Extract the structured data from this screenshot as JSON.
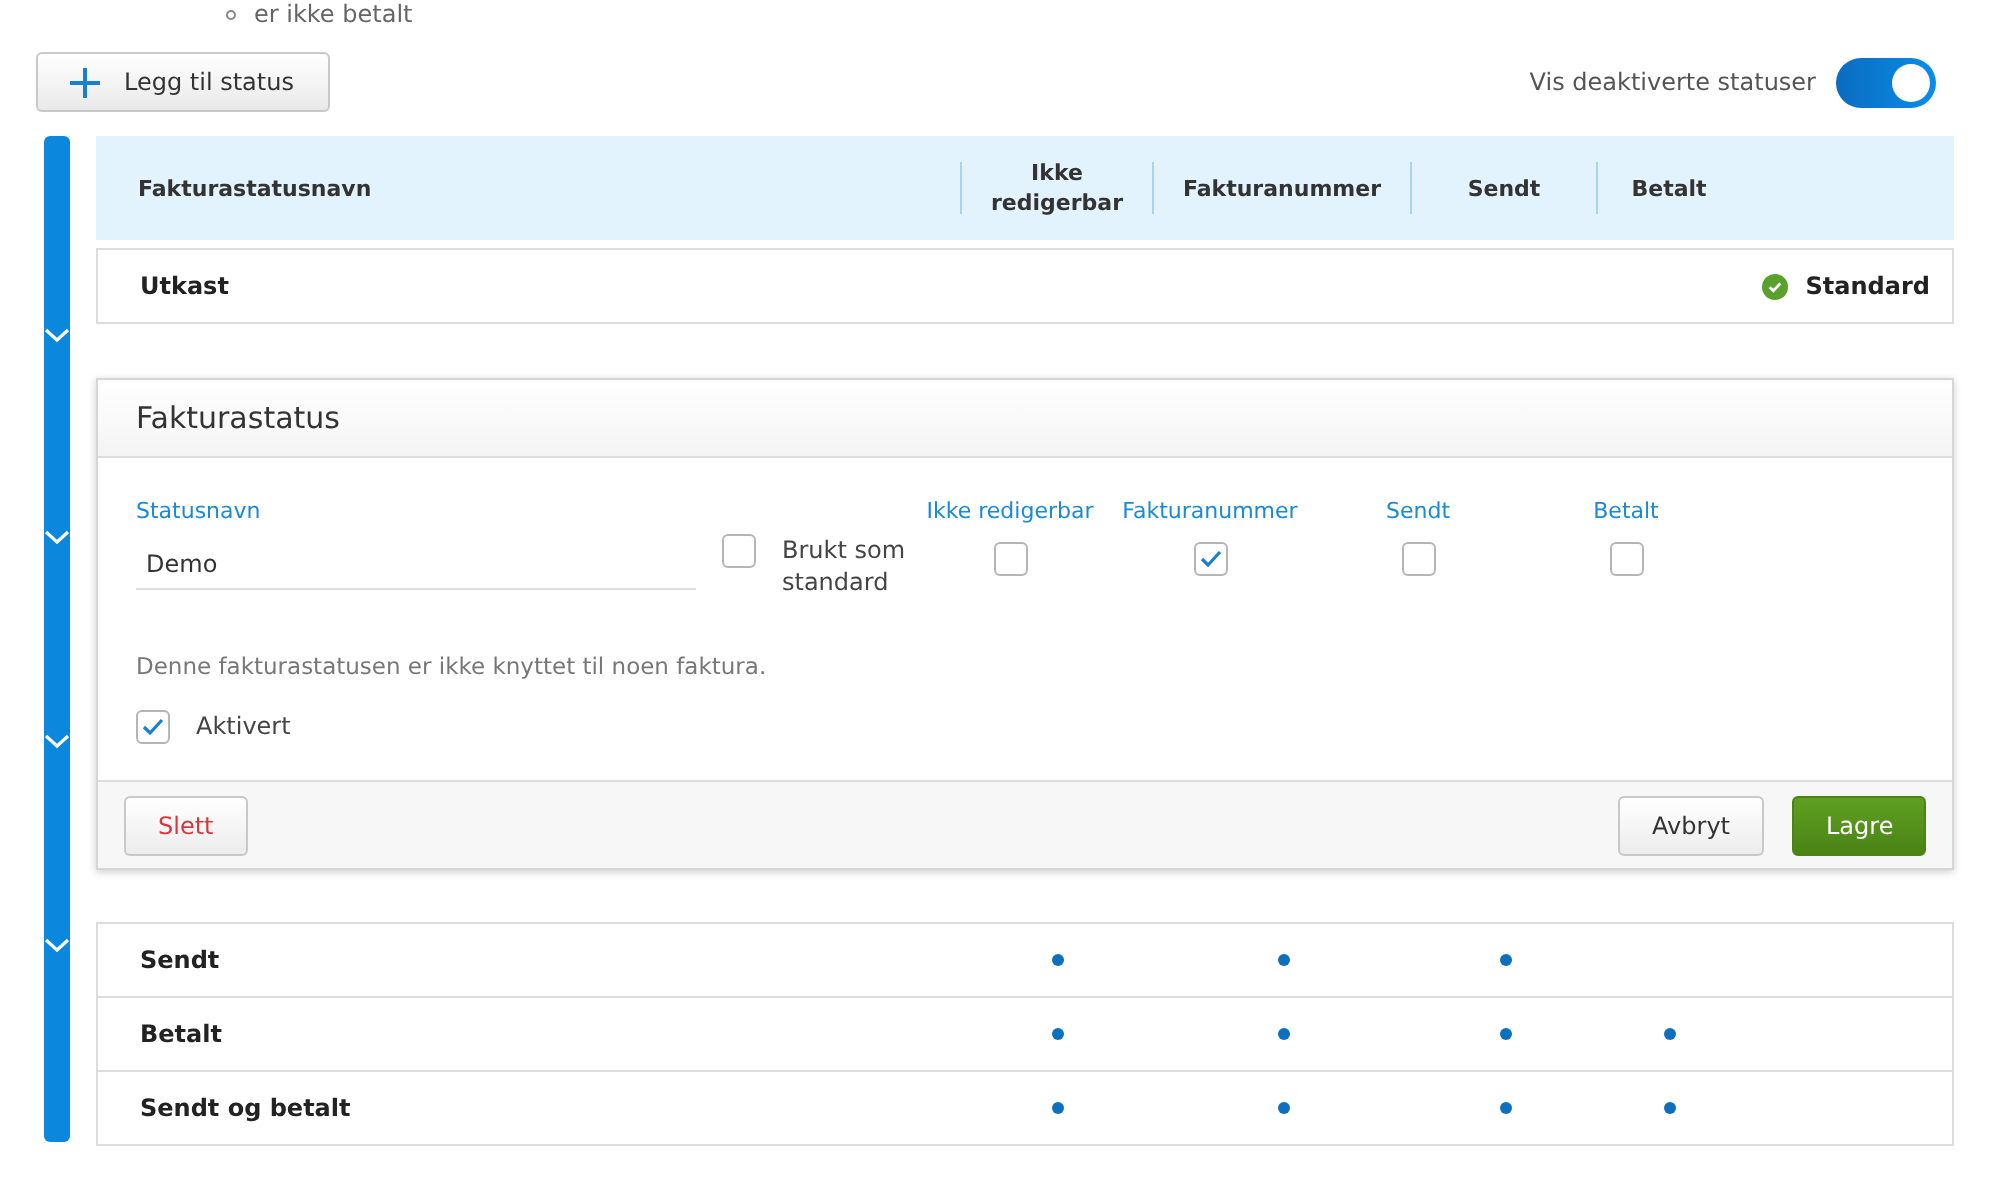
{
  "top_note": {
    "text": "er ikke betalt"
  },
  "add_button": {
    "label": "Legg til status"
  },
  "show_disabled": {
    "label": "Vis deaktiverte statuser",
    "on": true
  },
  "table": {
    "columns": [
      "Fakturastatusnavn",
      "Ikke redigerbar",
      "Fakturanummer",
      "Sendt",
      "Betalt"
    ],
    "rows_before": [
      {
        "name": "Utkast",
        "marks": [
          false,
          false,
          false,
          false
        ],
        "standard": true,
        "standard_label": "Standard"
      }
    ],
    "editor": {
      "title": "Fakturastatus",
      "name_field": {
        "label": "Statusnavn",
        "value": "Demo"
      },
      "default_checkbox": {
        "label": "Brukt som standard",
        "checked": false
      },
      "flags": [
        {
          "label": "Ikke redigerbar",
          "checked": false
        },
        {
          "label": "Fakturanummer",
          "checked": true
        },
        {
          "label": "Sendt",
          "checked": false
        },
        {
          "label": "Betalt",
          "checked": false
        }
      ],
      "info": "Denne fakturastatusen er ikke knyttet til noen faktura.",
      "active_checkbox": {
        "label": "Aktivert",
        "checked": true
      },
      "buttons": [
        {
          "label": "Slett",
          "kind": "danger"
        },
        {
          "label": "Avbryt",
          "kind": "default"
        },
        {
          "label": "Lagre",
          "kind": "primary"
        }
      ]
    },
    "rows_after": [
      {
        "name": "Sendt",
        "marks": [
          true,
          true,
          true,
          false
        ],
        "standard": false
      },
      {
        "name": "Betalt",
        "marks": [
          true,
          true,
          true,
          true
        ],
        "standard": false
      },
      {
        "name": "Sendt og betalt",
        "marks": [
          true,
          true,
          true,
          true
        ],
        "standard": false
      }
    ]
  }
}
